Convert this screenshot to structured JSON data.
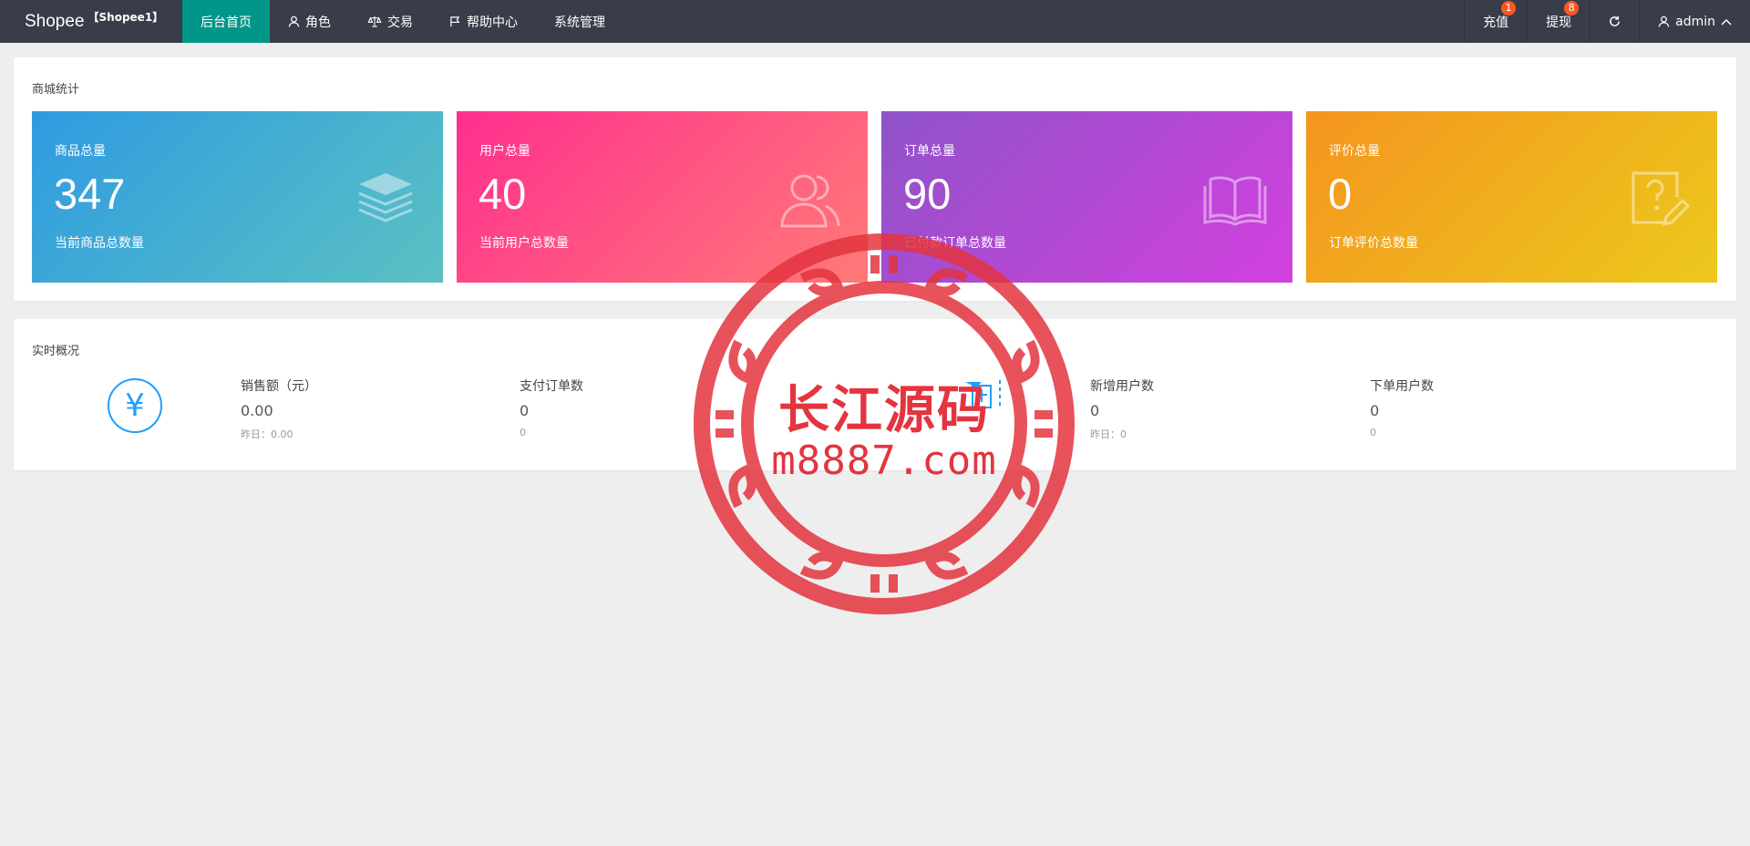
{
  "brand": {
    "name": "Shopee",
    "sub": "【Shopee1】"
  },
  "nav": [
    {
      "label": "后台首页",
      "icon": "none"
    },
    {
      "label": "角色",
      "icon": "user-icon"
    },
    {
      "label": "交易",
      "icon": "scale-icon"
    },
    {
      "label": "帮助中心",
      "icon": "flag-icon"
    },
    {
      "label": "系统管理",
      "icon": "none"
    }
  ],
  "right_nav": {
    "recharge": {
      "label": "充值",
      "badge": "1"
    },
    "withdraw": {
      "label": "提现",
      "badge": "8"
    },
    "refresh_icon": "refresh-icon",
    "user": {
      "label": "admin"
    }
  },
  "mall_stats": {
    "title": "商城统计",
    "cards": [
      {
        "label": "商品总量",
        "value": "347",
        "desc": "当前商品总数量",
        "icon": "layers-icon"
      },
      {
        "label": "用户总量",
        "value": "40",
        "desc": "当前用户总数量",
        "icon": "users-icon"
      },
      {
        "label": "订单总量",
        "value": "90",
        "desc": "已付款订单总数量",
        "icon": "book-icon"
      },
      {
        "label": "评价总量",
        "value": "0",
        "desc": "订单评价总数量",
        "icon": "question-edit-icon"
      }
    ]
  },
  "realtime": {
    "title": "实时概况",
    "metrics": [
      {
        "label": "销售额（元）",
        "value": "0.00",
        "prev": "昨日：0.00"
      },
      {
        "label": "支付订单数",
        "value": "0",
        "prev": "0"
      },
      {
        "label": "新增用户数",
        "value": "0",
        "prev": "昨日：0"
      },
      {
        "label": "下单用户数",
        "value": "0",
        "prev": "0"
      }
    ],
    "yen_symbol": "¥"
  },
  "watermark": {
    "line1": "长江源码",
    "line2": "m8887.com"
  },
  "colors": {
    "topbar": "#393d49",
    "active_nav": "#009688",
    "badge": "#ff5722",
    "accent_blue": "#1e9fff",
    "seal_red": "#e3343f"
  }
}
